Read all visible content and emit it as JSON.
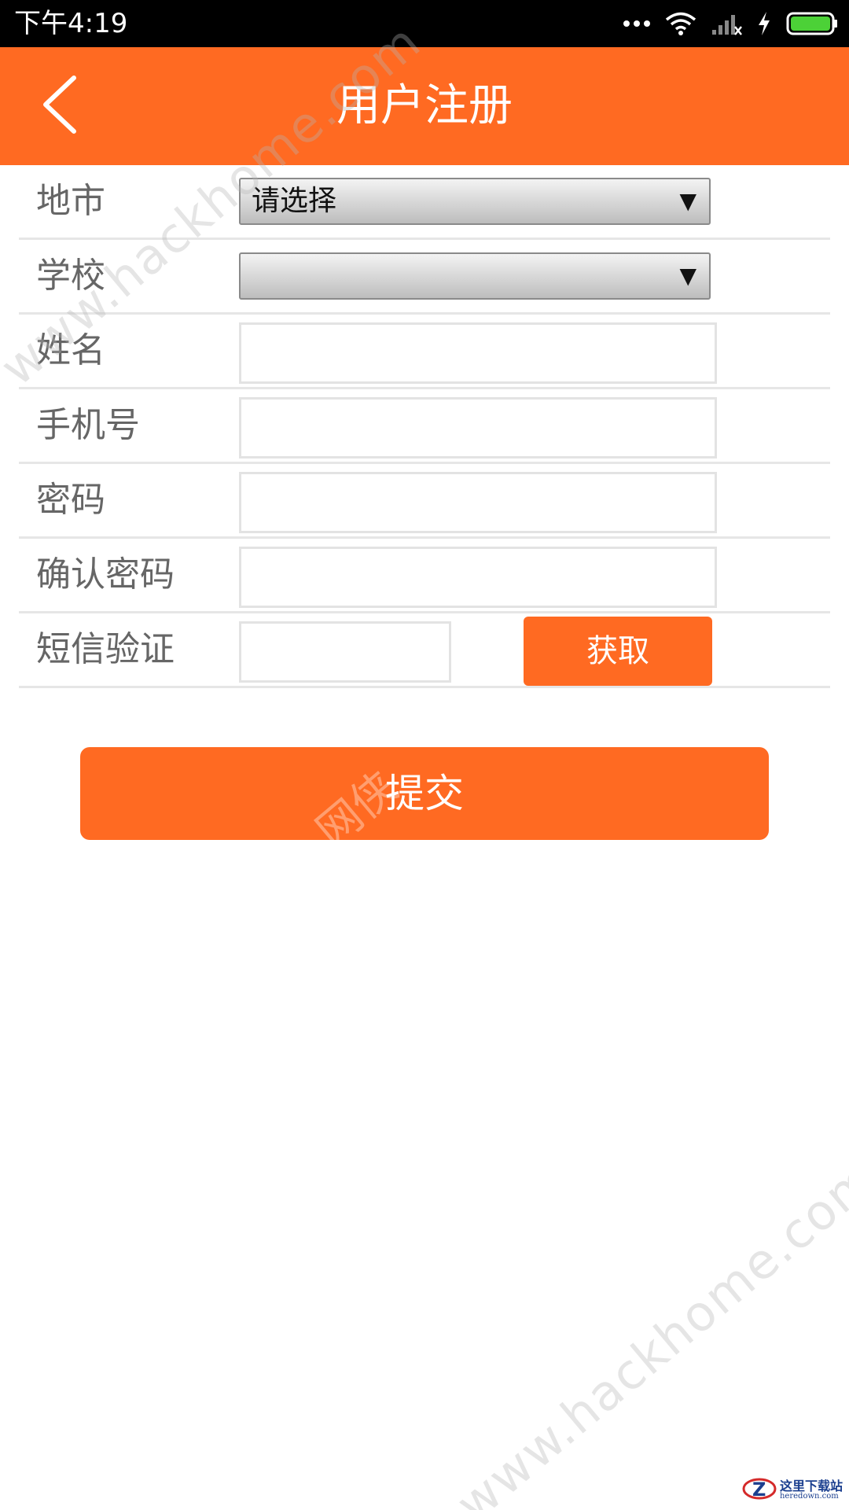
{
  "status_bar": {
    "time": "下午4:19",
    "icons": [
      "more-dots-icon",
      "wifi-icon",
      "signal-no-service-icon",
      "charging-bolt-icon",
      "battery-icon"
    ]
  },
  "app_bar": {
    "title": "用户注册",
    "back_icon": "back-chevron-icon",
    "background_color": "#ff6a22"
  },
  "form": {
    "city": {
      "label": "地市",
      "selected": "请选择",
      "arrow": "▼"
    },
    "school": {
      "label": "学校",
      "selected": "",
      "arrow": "▼"
    },
    "name": {
      "label": "姓名",
      "value": ""
    },
    "phone": {
      "label": "手机号",
      "value": ""
    },
    "password": {
      "label": "密码",
      "value": ""
    },
    "confirm_password": {
      "label": "确认密码",
      "value": ""
    },
    "sms_code": {
      "label": "短信验证",
      "value": "",
      "button_label": "获取"
    }
  },
  "submit": {
    "label": "提交"
  },
  "watermarks": {
    "url_top": "www.hackhome.com",
    "url_bottom": "www.hackhome.com",
    "center": "网侠",
    "logo_name": "这里下载站",
    "logo_url": "heredown.com"
  }
}
